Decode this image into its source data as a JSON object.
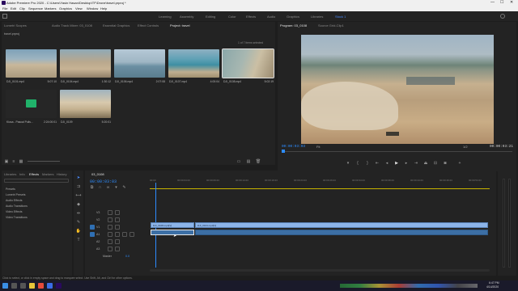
{
  "window": {
    "title": "Adobe Premiere Pro 2020 - C:\\Users\\Yasin Hasan\\Desktop\\TF\\Drone\\travel.prproj *",
    "min": "—",
    "max": "☐",
    "close": "✕"
  },
  "menu": [
    "File",
    "Edit",
    "Clip",
    "Sequence",
    "Markers",
    "Graphics",
    "View",
    "Window",
    "Help"
  ],
  "workspaces": [
    "Learning",
    "Assembly",
    "Editing",
    "Color",
    "Effects",
    "Audio",
    "Graphics",
    "Libraries",
    "Stock 1"
  ],
  "source_tabs": [
    "Lumetri Scopes",
    "Source: (no clips)",
    "Audio Track Mixer: 03_0108",
    "Essential Graphics",
    "Effect Controls",
    "Project: travel"
  ],
  "project": {
    "file": "travel.prproj",
    "selected_count": "1 of 7 items selected",
    "items": [
      {
        "name": "DJI_0101.mp4",
        "dur": "5:07:10"
      },
      {
        "name": "DJI_0104.mp4",
        "dur": "1:30:12"
      },
      {
        "name": "DJI_0106.mp4",
        "dur": "2:07:08"
      },
      {
        "name": "DJI_0107.mp4",
        "dur": "4:00:04"
      },
      {
        "name": "DJI_0108.mp4",
        "dur": "5:02:19"
      },
      {
        "name": "Kiosa - Pascal Pulis...",
        "dur": "2:24:00:01"
      },
      {
        "name": "DJI_0109",
        "dur": "5:20:01"
      }
    ]
  },
  "program": {
    "tab": "Program: 03_0108",
    "tab2": "Source Grid-Clip1",
    "timecode": "00:00:03:03",
    "fit": "Fit",
    "quality": "1/2",
    "duration": "00:00:03:21"
  },
  "effects": {
    "tabs": [
      "Libraries",
      "Info",
      "Effects",
      "Markers",
      "History"
    ],
    "items": [
      "Presets",
      "Lumetri Presets",
      "Audio Effects",
      "Audio Transitions",
      "Video Effects",
      "Video Transitions"
    ]
  },
  "timeline": {
    "sequence": "03_0108",
    "timecode": "00:00:03:03",
    "ruler": [
      "00:00",
      "00:00:04:23",
      "00:00:09:23",
      "00:00:14:23",
      "00:00:19:23",
      "00:00:24:23",
      "00:00:29:23",
      "00:00:34:23",
      "00:00:39:23",
      "00:00:44:23",
      "00:00:49:23",
      "00:00:54:23"
    ],
    "tracks": [
      "V3",
      "V2",
      "V1",
      "A1",
      "A2",
      "A3"
    ],
    "clips": [
      {
        "name": "DJI_0108.mp4[V]"
      },
      {
        "name": "DJI_0104.mp4[V]"
      }
    ],
    "master": "Master",
    "master_val": "0.0"
  },
  "status": "Click to select, or click in empty space and drag to marquee select. Use Shift, Alt, and Ctrl for other options.",
  "taskbar": {
    "time": "6:47 PM",
    "date": "4/14/2020"
  }
}
